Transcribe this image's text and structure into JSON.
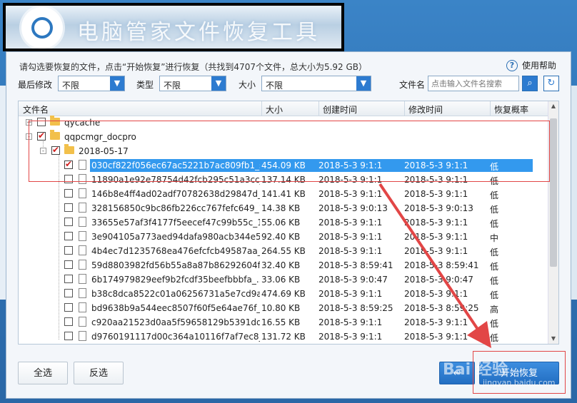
{
  "window": {
    "title": "电脑管家文件恢复工具"
  },
  "header": {
    "info": "请勾选要恢复的文件，点击“开始恢复”进行恢复（共找到4707个文件，总大小为5.92 GB）",
    "help_label": "使用帮助"
  },
  "filters": {
    "modified_label": "最后修改",
    "modified_value": "不限",
    "type_label": "类型",
    "type_value": "不限",
    "size_label": "大小",
    "size_value": "不限",
    "filename_label": "文件名",
    "search_placeholder": "点击输入文件名搜索"
  },
  "table": {
    "columns": [
      "文件名",
      "大小",
      "创建时间",
      "修改时间",
      "恢复概率"
    ],
    "tree": [
      {
        "name": "qycache",
        "level": 0,
        "checked": false,
        "expander": "+"
      },
      {
        "name": "qqpcmgr_docpro",
        "level": 0,
        "checked": true,
        "expander": "-"
      },
      {
        "name": "2018-05-17",
        "level": 1,
        "checked": true,
        "expander": "-"
      }
    ],
    "rows": [
      {
        "name": "030cf822f056ec67ac5221b7ac809fb1_s...",
        "size": "454.09 KB",
        "created": "2018-5-3 9:1:1",
        "modified": "2018-5-3 9:1:1",
        "prob": "低",
        "checked": true,
        "selected": true
      },
      {
        "name": "11890a1e92e78754d42fcb295c51a3cc_...",
        "size": "137.14 KB",
        "created": "2018-5-3 9:1:1",
        "modified": "2018-5-3 9:1:1",
        "prob": "低",
        "checked": false
      },
      {
        "name": "146b8e4ff4ad02adf70782638d29847d_...",
        "size": "141.41 KB",
        "created": "2018-5-3 9:1:1",
        "modified": "2018-5-3 9:1:1",
        "prob": "低",
        "checked": false
      },
      {
        "name": "328156850c9bc86fb226cc767fefc649_1...",
        "size": "14.38 KB",
        "created": "2018-5-3 9:0:13",
        "modified": "2018-5-3 9:0:13",
        "prob": "低",
        "checked": false
      },
      {
        "name": "33655e57af3f4177f5eecef47c99b55c_1...",
        "size": "55.06 KB",
        "created": "2018-5-3 9:1:1",
        "modified": "2018-5-3 9:1:1",
        "prob": "低",
        "checked": false
      },
      {
        "name": "3e904105a773aed94dafa980acb344e5...",
        "size": "92.40 KB",
        "created": "2018-5-3 9:1:1",
        "modified": "2018-5-3 9:1:1",
        "prob": "中",
        "checked": false
      },
      {
        "name": "4b4ec7d1235768ea476efcfcb49587aa_...",
        "size": "264.55 KB",
        "created": "2018-5-3 9:1:1",
        "modified": "2018-5-3 9:1:1",
        "prob": "低",
        "checked": false
      },
      {
        "name": "59d8803982fd56b55a8a87b86292604f...",
        "size": "32.40 KB",
        "created": "2018-5-3 8:59:41",
        "modified": "2018-5-3 8:59:41",
        "prob": "低",
        "checked": false
      },
      {
        "name": "6b174979829eef9b2fcdf35beefbbbfa_...",
        "size": "33.06 KB",
        "created": "2018-5-3 9:0:47",
        "modified": "2018-5-3 9:0:47",
        "prob": "低",
        "checked": false
      },
      {
        "name": "b38c8dca8522c01a06256731a5e7cd9a...",
        "size": "474.69 KB",
        "created": "2018-5-3 9:1:1",
        "modified": "2018-5-3 9:1:1",
        "prob": "低",
        "checked": false
      },
      {
        "name": "bd9638b9a544eec8507f60f5e64ae76f_...",
        "size": "10.80 KB",
        "created": "2018-5-3 8:59:25",
        "modified": "2018-5-3 8:59:25",
        "prob": "高",
        "checked": false
      },
      {
        "name": "c920aa21523d0aa5f59658129b5391dd...",
        "size": "16.55 KB",
        "created": "2018-5-3 9:1:1",
        "modified": "2018-5-3 9:1:1",
        "prob": "低",
        "checked": false
      },
      {
        "name": "d9760191117d00c364a10116f7af7ec8_...",
        "size": "131.72 KB",
        "created": "2018-5-3 9:1:1",
        "modified": "2018-5-3 9:1:1",
        "prob": "低",
        "checked": false
      }
    ]
  },
  "footer": {
    "select_all": "全选",
    "invert": "反选",
    "back": "返回",
    "start_recover": "开始恢复"
  },
  "watermark": {
    "main": "Bai 经验",
    "sub": "jingyan.baidu.com"
  },
  "colors": {
    "accent": "#2d7bd0",
    "selected_row": "#3399ee",
    "annotation_red": "#e24646"
  }
}
